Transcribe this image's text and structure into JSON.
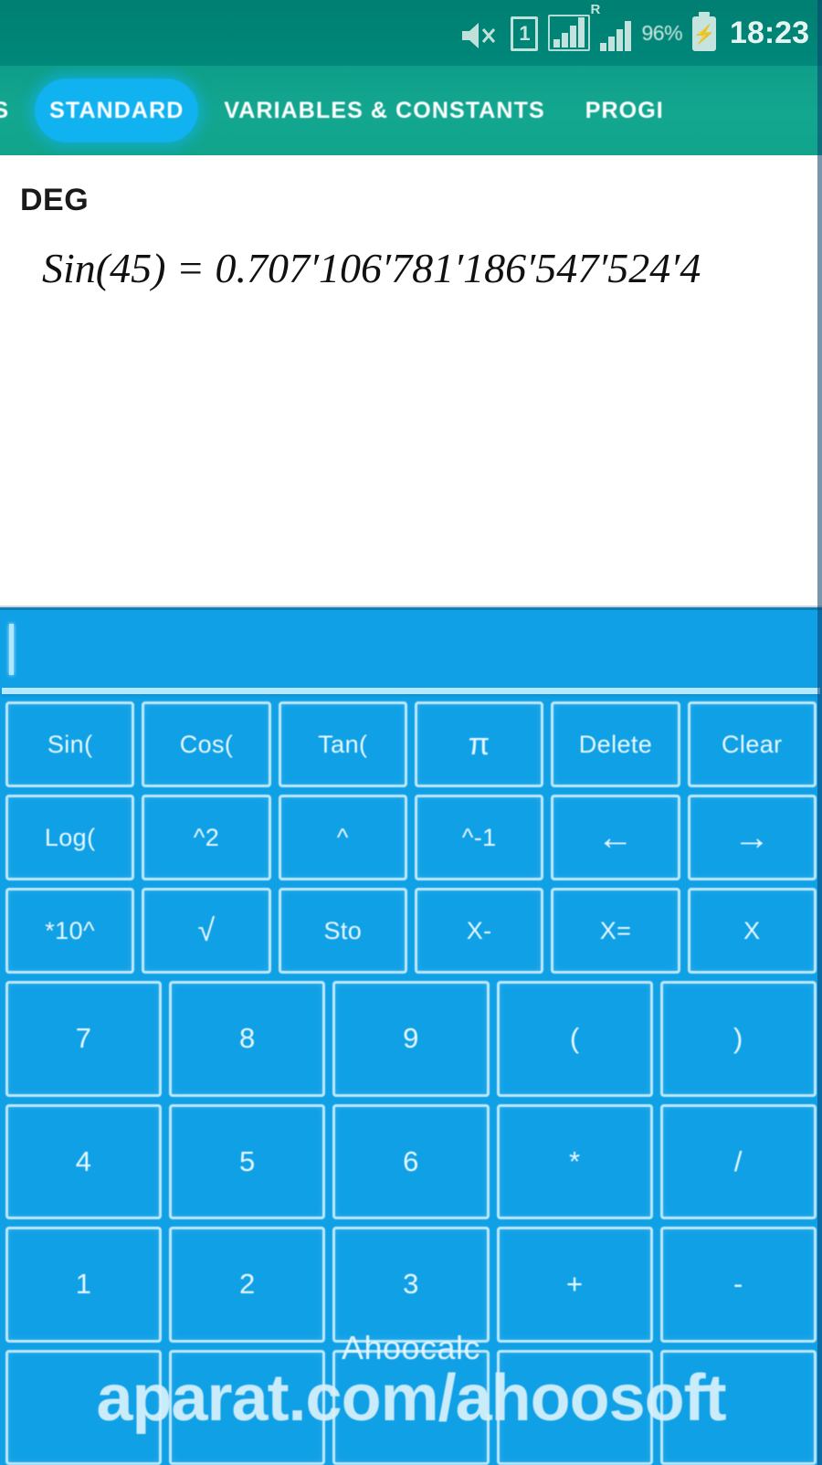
{
  "status_bar": {
    "mute_icon": "mute-icon",
    "sim_label": "1",
    "signal_icon": "signal-bars-icon",
    "roaming_label": "R",
    "battery_percent": "96%",
    "battery_icon": "battery-charging-icon",
    "time": "18:23"
  },
  "tabs": [
    {
      "label": "LS",
      "active": false
    },
    {
      "label": "STANDARD",
      "active": true
    },
    {
      "label": "VARIABLES & CONSTANTS",
      "active": false
    },
    {
      "label": "PROGI",
      "active": false
    }
  ],
  "display": {
    "angle_mode": "DEG",
    "expression": "Sin(45) = 0.707′106′781′186′547′524′4"
  },
  "input": {
    "value": "",
    "placeholder": ""
  },
  "keypad": {
    "rows": [
      {
        "type": "fn",
        "keys": [
          {
            "label": "Sin("
          },
          {
            "label": "Cos("
          },
          {
            "label": "Tan("
          },
          {
            "label": "π"
          },
          {
            "label": "Delete"
          },
          {
            "label": "Clear"
          }
        ]
      },
      {
        "type": "fn",
        "keys": [
          {
            "label": "Log("
          },
          {
            "label": "^2"
          },
          {
            "label": "^"
          },
          {
            "label": "^-1"
          },
          {
            "label": "←"
          },
          {
            "label": "→"
          }
        ]
      },
      {
        "type": "fn",
        "keys": [
          {
            "label": "*10^"
          },
          {
            "label": "√"
          },
          {
            "label": "Sto"
          },
          {
            "label": "X-"
          },
          {
            "label": "X="
          },
          {
            "label": "X"
          }
        ]
      },
      {
        "type": "num",
        "keys": [
          {
            "label": "7"
          },
          {
            "label": "8"
          },
          {
            "label": "9"
          },
          {
            "label": "("
          },
          {
            "label": ")"
          }
        ]
      },
      {
        "type": "num",
        "keys": [
          {
            "label": "4"
          },
          {
            "label": "5"
          },
          {
            "label": "6"
          },
          {
            "label": "*"
          },
          {
            "label": "/"
          }
        ]
      },
      {
        "type": "num",
        "keys": [
          {
            "label": "1"
          },
          {
            "label": "2"
          },
          {
            "label": "3"
          },
          {
            "label": "+"
          },
          {
            "label": "-"
          }
        ]
      },
      {
        "type": "num",
        "keys": [
          {
            "label": ""
          },
          {
            "label": ""
          },
          {
            "label": ""
          },
          {
            "label": ""
          },
          {
            "label": ""
          }
        ]
      }
    ]
  },
  "watermark": {
    "app_name": "Ahoocalc",
    "url": "aparat.com/ahoosoft"
  },
  "colors": {
    "status_green": "#007f72",
    "tab_green": "#13a790",
    "accent_blue": "#11b2f0",
    "keypad_blue": "#0FA0E6",
    "key_border": "#bfe9fb",
    "display_bg": "#ffffff"
  }
}
